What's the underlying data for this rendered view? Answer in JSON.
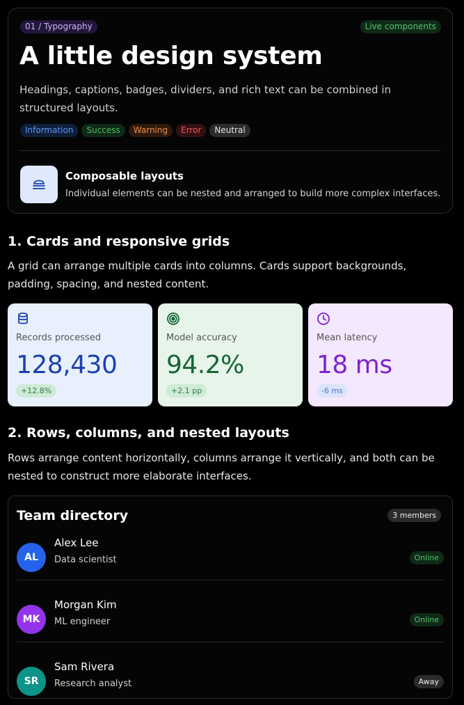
{
  "hero": {
    "eyebrow": "01 / Typography",
    "status_badge": "Live components",
    "title": "A little design system",
    "lead": "Headings, captions, badges, dividers, and rich text can be combined in structured layouts.",
    "badges": [
      "Information",
      "Success",
      "Warning",
      "Error",
      "Neutral"
    ],
    "feature": {
      "icon": "layers-icon",
      "title": "Composable layouts",
      "description": "Individual elements can be nested and arranged to build more complex interfaces."
    }
  },
  "section1": {
    "title": "1. Cards and responsive grids",
    "body": "A grid can arrange multiple cards into columns. Cards support backgrounds, padding, spacing, and nested content."
  },
  "stats": [
    {
      "icon": "database-icon",
      "label": "Records processed",
      "value": "128,430",
      "delta": "+12.8%",
      "accent": "#1e40af",
      "bg": "#e8f0fd"
    },
    {
      "icon": "target-icon",
      "label": "Model accuracy",
      "value": "94.2%",
      "delta": "+2.1 pp",
      "accent": "#166534",
      "bg": "#e6f4ea"
    },
    {
      "icon": "clock-icon",
      "label": "Mean latency",
      "value": "18 ms",
      "delta": "-6 ms",
      "accent": "#7e22ce",
      "bg": "#f3e8fd"
    }
  ],
  "section2": {
    "title": "2. Rows, columns, and nested layouts",
    "body": "Rows arrange content horizontally, columns arrange it vertically, and both can be nested to construct more elaborate interfaces."
  },
  "team": {
    "title": "Team directory",
    "count": "3 members",
    "members": [
      {
        "initials": "AL",
        "name": "Alex Lee",
        "role": "Data scientist",
        "status": "Online",
        "avatar_color": "#2563eb"
      },
      {
        "initials": "MK",
        "name": "Morgan Kim",
        "role": "ML engineer",
        "status": "Online",
        "avatar_color": "#9333ea"
      },
      {
        "initials": "SR",
        "name": "Sam Rivera",
        "role": "Research analyst",
        "status": "Away",
        "avatar_color": "#0d9488"
      }
    ]
  }
}
